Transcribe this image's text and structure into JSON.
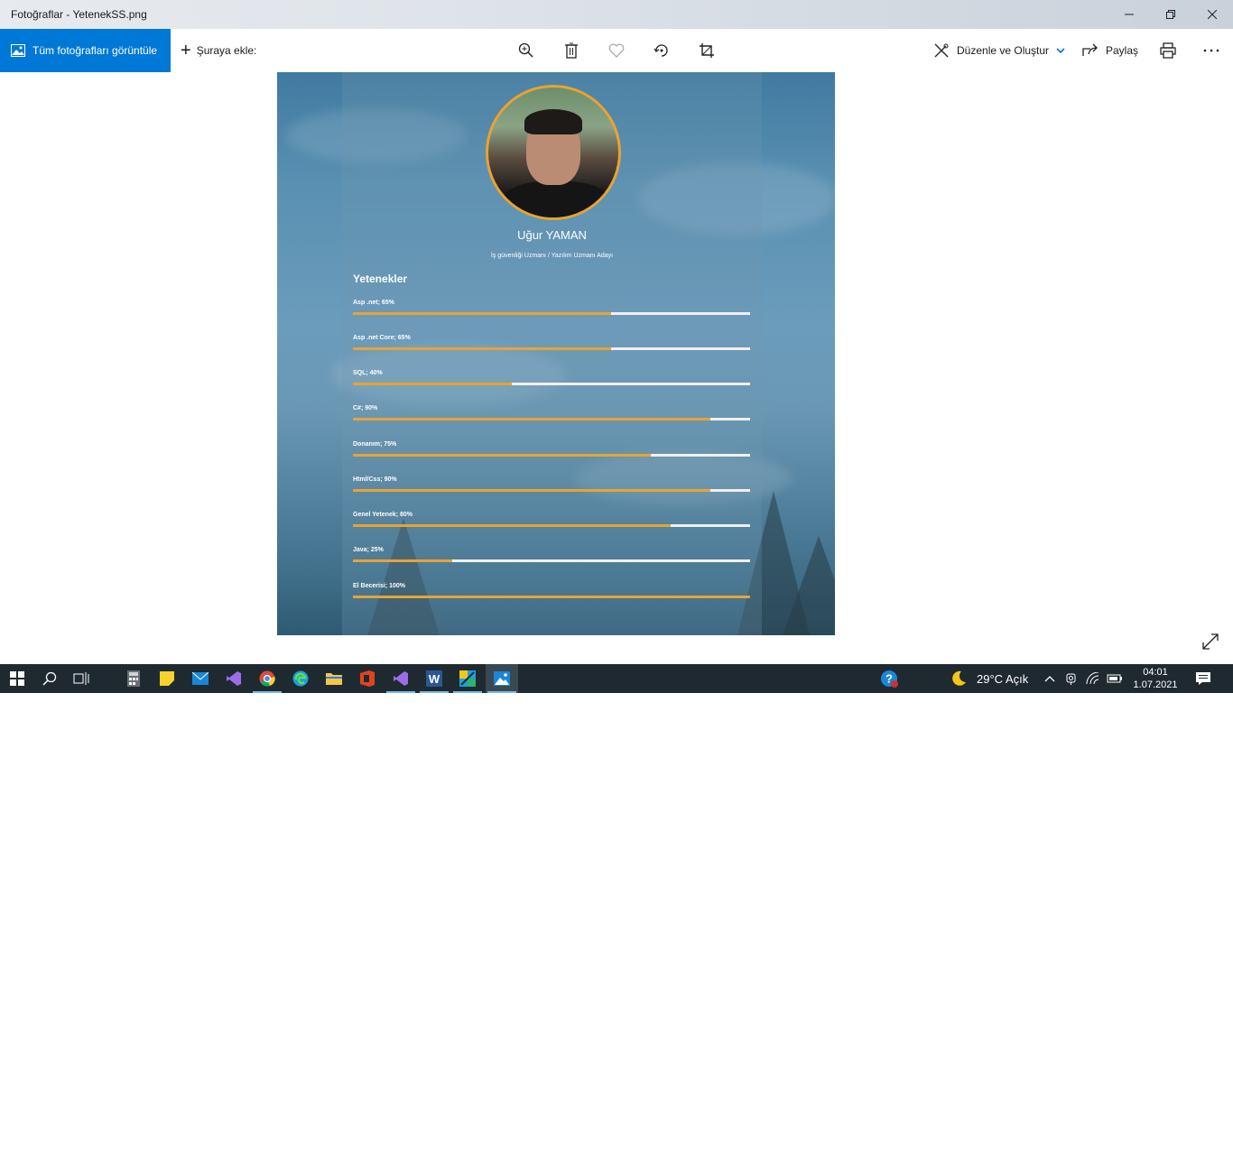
{
  "window": {
    "title": "Fotoğraflar - YetenekSS.png"
  },
  "toolbar": {
    "view_all_label": "Tüm fotoğrafları görüntüle",
    "add_to_label": "Şuraya ekle:",
    "edit_create_label": "Düzenle ve Oluştur",
    "share_label": "Paylaş"
  },
  "photo": {
    "name": "Uğur YAMAN",
    "subtitle": "İş güvenliği Uzmanı / Yazılım Uzmanı Adayı",
    "skills_heading": "Yetenekler",
    "skills": [
      {
        "label": "Asp .net; 65%",
        "value": 65
      },
      {
        "label": "Asp .net Core; 65%",
        "value": 65
      },
      {
        "label": "SQL; 40%",
        "value": 40
      },
      {
        "label": "C#; 90%",
        "value": 90
      },
      {
        "label": "Donanım; 75%",
        "value": 75
      },
      {
        "label": "Html/Css; 90%",
        "value": 90
      },
      {
        "label": "Genel Yetenek; 80%",
        "value": 80
      },
      {
        "label": "Java; 25%",
        "value": 25
      },
      {
        "label": "El Becerisi; 100%",
        "value": 100
      }
    ],
    "accent_color": "#e8a333"
  },
  "taskbar": {
    "weather": "29°C  Açık",
    "time": "04:01",
    "date": "1.07.2021",
    "apps": [
      "calculator",
      "sticky-notes",
      "mail",
      "visual-studio",
      "chrome",
      "edge",
      "file-explorer",
      "office",
      "visual-studio-2",
      "word",
      "snip-sketch",
      "photos"
    ]
  }
}
